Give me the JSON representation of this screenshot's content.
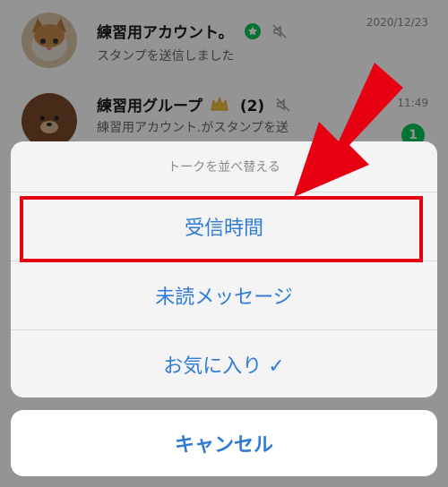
{
  "chats": [
    {
      "name": "練習用アカウント。",
      "preview": "スタンプを送信しました",
      "time": "2020/12/23",
      "icons": [
        "star-badge-icon",
        "muted-icon"
      ],
      "avatar": "kitten-photo"
    },
    {
      "name": "練習用グループ",
      "member_count": "(2)",
      "preview": "練習用アカウント.がスタンプを送",
      "time": "11:49",
      "unread": "1",
      "icons": [
        "crown-icon",
        "muted-icon"
      ],
      "avatar": "brown-bear"
    }
  ],
  "sort_sheet": {
    "title": "トークを並べ替える",
    "options": [
      {
        "label": "受信時間",
        "highlighted": true
      },
      {
        "label": "未読メッセージ"
      },
      {
        "label": "お気に入り ✓"
      }
    ],
    "cancel_label": "キャンセル"
  },
  "colors": {
    "action_blue": "#2f7bd6",
    "annotation_red": "#e60012",
    "line_green": "#06c755"
  }
}
